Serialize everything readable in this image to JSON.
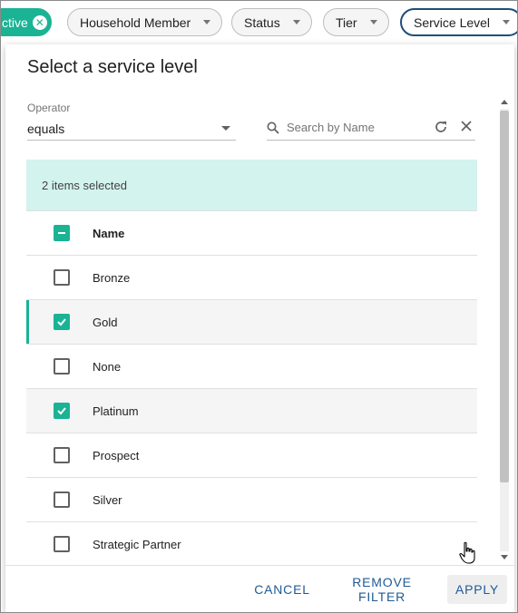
{
  "chips": {
    "active": {
      "label": "ctive"
    },
    "household": {
      "label": "Household Member"
    },
    "status": {
      "label": "Status"
    },
    "tier": {
      "label": "Tier"
    },
    "service_level": {
      "label": "Service Level"
    }
  },
  "dialog": {
    "title": "Select a service level",
    "operator": {
      "label": "Operator",
      "value": "equals"
    },
    "search": {
      "placeholder": "Search by Name",
      "value": ""
    },
    "selection_summary": "2 items selected",
    "column_header": "Name",
    "items": [
      {
        "label": "Bronze",
        "checked": false
      },
      {
        "label": "Gold",
        "checked": true
      },
      {
        "label": "None",
        "checked": false
      },
      {
        "label": "Platinum",
        "checked": true
      },
      {
        "label": "Prospect",
        "checked": false
      },
      {
        "label": "Silver",
        "checked": false
      },
      {
        "label": "Strategic Partner",
        "checked": false
      }
    ],
    "buttons": {
      "cancel": "CANCEL",
      "remove_filter": "REMOVE FILTER",
      "apply": "APPLY"
    }
  },
  "colors": {
    "accent": "#1ab394",
    "banner": "#d3f3ee",
    "button_text": "#1f5a96"
  }
}
